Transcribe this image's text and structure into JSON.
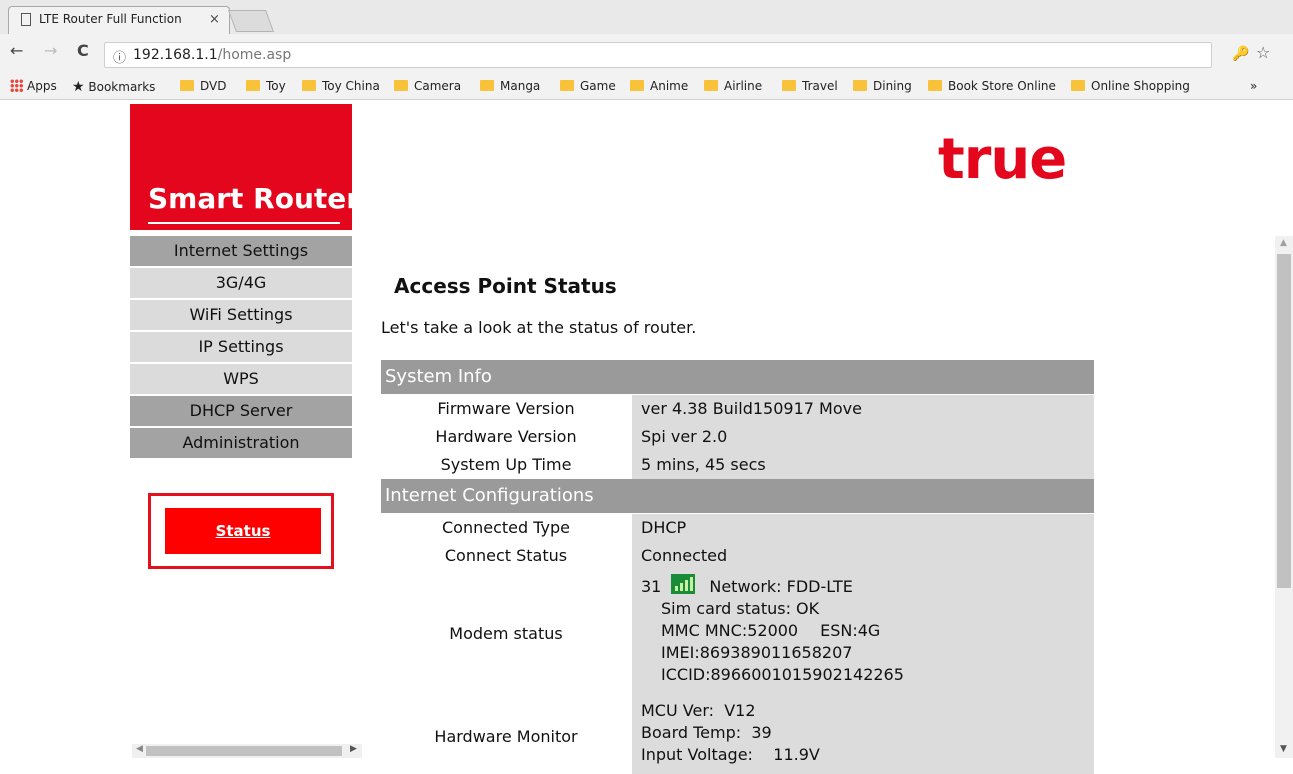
{
  "browser": {
    "tab_title": "LTE Router Full Function",
    "tab_close": "×",
    "url_host": "192.168.1.1",
    "url_path": "/home.asp",
    "back": "←",
    "forward": "→",
    "reload": "C",
    "info": "ⓘ",
    "star": "☆",
    "key": "🔑"
  },
  "bookmarks": {
    "apps": "Apps",
    "bookmarks_label": "Bookmarks",
    "star": "★",
    "folders": [
      "DVD",
      "Toy",
      "Toy China",
      "Camera",
      "Manga",
      "Game",
      "Anime",
      "Airline",
      "Travel",
      "Dining",
      "Book Store Online",
      "Online Shopping"
    ],
    "more": "»"
  },
  "page": {
    "logo_text": "Smart Router",
    "brand": "true",
    "menu": [
      "Internet Settings",
      "3G/4G",
      "WiFi Settings",
      "IP Settings",
      "WPS",
      "DHCP Server",
      "Administration"
    ],
    "status_button": "Status",
    "heading": "Access Point Status",
    "intro": "Let's take a look at the status of router.",
    "sections": {
      "system_info": "System Info",
      "internet": "Internet Configurations"
    },
    "system_info": {
      "firmware_label": "Firmware Version",
      "firmware_value": "ver 4.38 Build150917 Move",
      "hardware_label": "Hardware Version",
      "hardware_value": "Spi ver 2.0",
      "uptime_label": "System Up Time",
      "uptime_value": "5 mins, 45 secs"
    },
    "internet": {
      "type_label": "Connected Type",
      "type_value": "DHCP",
      "status_label": "Connect Status",
      "status_value": "Connected",
      "modem_label": "Modem status",
      "signal": "31",
      "network": "Network: FDD-LTE",
      "sim": "Sim card status: OK",
      "mmc": "MMC MNC:52000",
      "esn": "ESN:4G",
      "imei": "IMEI:869389011658207",
      "iccid": "ICCID:8966001015902142265",
      "hw_label": "Hardware Monitor",
      "mcu": "MCU Ver:",
      "mcu_value": "V12",
      "board_temp": "Board Temp:",
      "board_temp_value": "39",
      "input_voltage": "Input Voltage:",
      "input_voltage_value": "11.9V"
    }
  }
}
